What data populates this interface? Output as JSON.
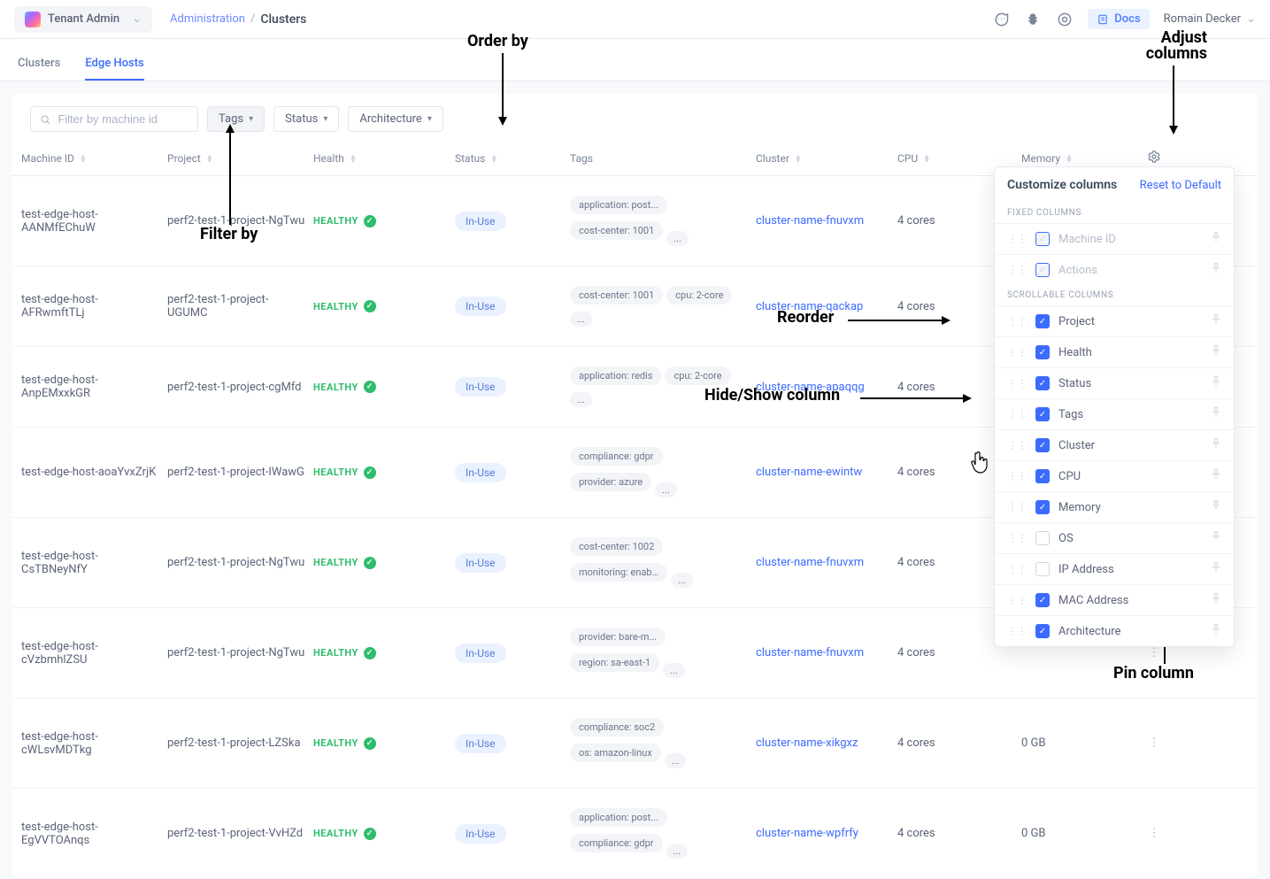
{
  "header": {
    "tenant": "Tenant Admin",
    "breadcrumb_parent": "Administration",
    "breadcrumb_current": "Clusters",
    "docs": "Docs",
    "user": "Romain Decker"
  },
  "tabs": {
    "clusters": "Clusters",
    "edge_hosts": "Edge Hosts"
  },
  "filters": {
    "search_placeholder": "Filter by machine id",
    "tags": "Tags",
    "status": "Status",
    "architecture": "Architecture"
  },
  "columns": {
    "machine_id": "Machine ID",
    "project": "Project",
    "health": "Health",
    "status": "Status",
    "tags": "Tags",
    "cluster": "Cluster",
    "cpu": "CPU",
    "memory": "Memory"
  },
  "rows": [
    {
      "machine_id": "test-edge-host-AANMfEChuW",
      "project": "perf2-test-1-project-NgTwu",
      "health": "HEALTHY",
      "status": "In-Use",
      "tags": [
        "application: post...",
        "cost-center: 1001"
      ],
      "more": true,
      "cluster": "cluster-name-fnuvxm",
      "cpu": "4 cores",
      "memory": ""
    },
    {
      "machine_id": "test-edge-host-AFRwmftTLj",
      "project": "perf2-test-1-project-UGUMC",
      "health": "HEALTHY",
      "status": "In-Use",
      "tags": [
        "cost-center: 1001",
        "cpu: 2-core"
      ],
      "more": true,
      "cluster": "cluster-name-qackap",
      "cpu": "4 cores",
      "memory": ""
    },
    {
      "machine_id": "test-edge-host-AnpEMxxkGR",
      "project": "perf2-test-1-project-cgMfd",
      "health": "HEALTHY",
      "status": "In-Use",
      "tags": [
        "application: redis",
        "cpu: 2-core"
      ],
      "more": true,
      "cluster": "cluster-name-apaqqg",
      "cpu": "4 cores",
      "memory": ""
    },
    {
      "machine_id": "test-edge-host-aoaYvxZrjK",
      "project": "perf2-test-1-project-IWawG",
      "health": "HEALTHY",
      "status": "In-Use",
      "tags": [
        "compliance: gdpr",
        "provider: azure"
      ],
      "more": true,
      "cluster": "cluster-name-ewintw",
      "cpu": "4 cores",
      "memory": ""
    },
    {
      "machine_id": "test-edge-host-CsTBNeyNfY",
      "project": "perf2-test-1-project-NgTwu",
      "health": "HEALTHY",
      "status": "In-Use",
      "tags": [
        "cost-center: 1002",
        "monitoring: enab..."
      ],
      "more": true,
      "cluster": "cluster-name-fnuvxm",
      "cpu": "4 cores",
      "memory": ""
    },
    {
      "machine_id": "test-edge-host-cVzbmhlZSU",
      "project": "perf2-test-1-project-NgTwu",
      "health": "HEALTHY",
      "status": "In-Use",
      "tags": [
        "provider: bare-m...",
        "region: sa-east-1"
      ],
      "more": true,
      "cluster": "cluster-name-fnuvxm",
      "cpu": "4 cores",
      "memory": ""
    },
    {
      "machine_id": "test-edge-host-cWLsvMDTkg",
      "project": "perf2-test-1-project-LZSka",
      "health": "HEALTHY",
      "status": "In-Use",
      "tags": [
        "compliance: soc2",
        "os: amazon-linux"
      ],
      "more": true,
      "cluster": "cluster-name-xikgxz",
      "cpu": "4 cores",
      "memory": "0 GB"
    },
    {
      "machine_id": "test-edge-host-EgVVTOAnqs",
      "project": "perf2-test-1-project-VvHZd",
      "health": "HEALTHY",
      "status": "In-Use",
      "tags": [
        "application: post...",
        "compliance: gdpr"
      ],
      "more": true,
      "cluster": "cluster-name-wpfrfy",
      "cpu": "4 cores",
      "memory": "0 GB"
    }
  ],
  "panel": {
    "title": "Customize columns",
    "reset": "Reset to Default",
    "fixed_label": "FIXED COLUMNS",
    "scrollable_label": "SCROLLABLE COLUMNS",
    "fixed": [
      {
        "name": "Machine ID",
        "checked": true,
        "disabled": true
      },
      {
        "name": "Actions",
        "checked": true,
        "disabled": true
      }
    ],
    "scrollable": [
      {
        "name": "Project",
        "checked": true
      },
      {
        "name": "Health",
        "checked": true
      },
      {
        "name": "Status",
        "checked": true
      },
      {
        "name": "Tags",
        "checked": true
      },
      {
        "name": "Cluster",
        "checked": true
      },
      {
        "name": "CPU",
        "checked": true
      },
      {
        "name": "Memory",
        "checked": true
      },
      {
        "name": "OS",
        "checked": false
      },
      {
        "name": "IP Address",
        "checked": false
      },
      {
        "name": "MAC Address",
        "checked": true
      },
      {
        "name": "Architecture",
        "checked": true
      }
    ]
  },
  "annotations": {
    "order_by": "Order by",
    "filter_by": "Filter by",
    "adjust_columns": "Adjust columns",
    "reorder": "Reorder",
    "hide_show": "Hide/Show column",
    "pin_column": "Pin column"
  },
  "misc": {
    "more": "..."
  }
}
